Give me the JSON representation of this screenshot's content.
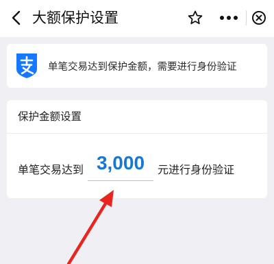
{
  "header": {
    "title": "大额保护设置",
    "back_icon": "chevron-left-icon",
    "star_icon": "star-outline-icon",
    "more_icon": "more-dots-icon",
    "close_icon": "close-circle-icon"
  },
  "notice": {
    "logo_icon": "alipay-logo-icon",
    "logo_color": "#1677ff",
    "text": "单笔交易达到保护金额，需要进行身份验证"
  },
  "protection_card": {
    "heading": "保护金额设置",
    "prefix_label": "单笔交易达到",
    "amount": "3,000",
    "suffix_label": "元进行身份验证",
    "amount_color": "#1677d6"
  },
  "annotation": {
    "arrow_icon": "red-arrow-icon",
    "arrow_color": "#e8261f"
  }
}
